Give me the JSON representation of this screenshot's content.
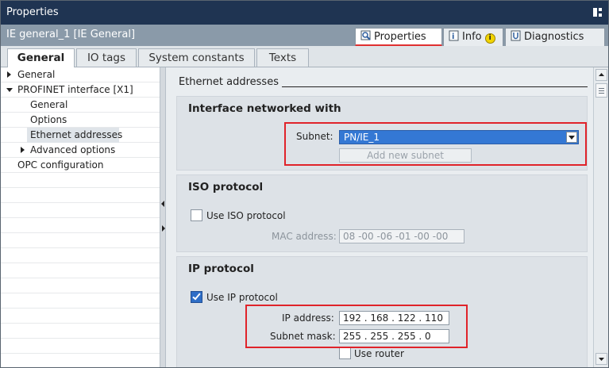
{
  "window": {
    "title": "Properties"
  },
  "objectbar": {
    "name": "IE general_1 [IE General]",
    "tabs": [
      {
        "label": "Properties",
        "icon": "properties-icon",
        "active": true
      },
      {
        "label": "Info",
        "icon": "info-icon",
        "badge": "i"
      },
      {
        "label": "Diagnostics",
        "icon": "diagnostics-icon"
      }
    ]
  },
  "subtabs": [
    "General",
    "IO tags",
    "System constants",
    "Texts"
  ],
  "tree": [
    {
      "label": "General",
      "expander": "collapsed"
    },
    {
      "label": "PROFINET interface [X1]",
      "expander": "expanded"
    },
    {
      "label": "General"
    },
    {
      "label": "Options"
    },
    {
      "label": "Ethernet addresses",
      "selected": true
    },
    {
      "label": "Advanced options",
      "expander": "collapsed"
    },
    {
      "label": "OPC configuration"
    }
  ],
  "content": {
    "section_header": "Ethernet addresses",
    "interface_group": {
      "title": "Interface networked with",
      "subnet_label": "Subnet:",
      "subnet_value": "PN/IE_1",
      "add_subnet_button": "Add new subnet"
    },
    "iso_group": {
      "title": "ISO protocol",
      "use_iso_label": "Use ISO protocol",
      "use_iso_checked": false,
      "mac_label": "MAC address:",
      "mac_value": "08 -00 -06 -01 -00 -00"
    },
    "ip_group": {
      "title": "IP protocol",
      "use_ip_label": "Use IP protocol",
      "use_ip_checked": true,
      "ip_label": "IP address:",
      "ip_value": "192 . 168 . 122 . 110",
      "mask_label": "Subnet mask:",
      "mask_value": "255 . 255 . 255 . 0",
      "use_router_label": "Use router",
      "use_router_checked": false
    }
  },
  "colors": {
    "titlebar": "#1f3452",
    "objectbar": "#8a9aa9",
    "highlight_box": "#e0232a",
    "selection": "#3478d4"
  }
}
